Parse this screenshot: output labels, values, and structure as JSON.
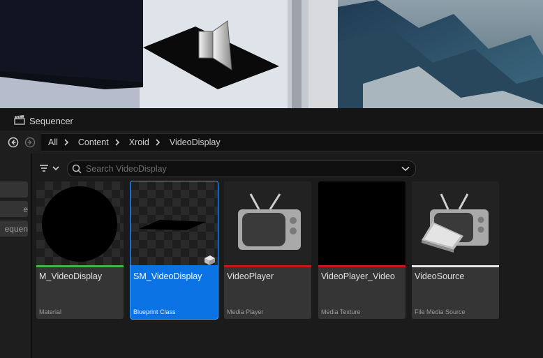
{
  "viewport": {
    "icons": {
      "speaker": "speaker-icon"
    }
  },
  "tab": {
    "title": "Sequencer",
    "icon": "clapperboard-icon"
  },
  "nav": {
    "back_icon": "back-arrow-icon",
    "forward_icon": "forward-arrow-icon",
    "breadcrumbs": [
      "All",
      "Content",
      "Xroid",
      "VideoDisplay"
    ]
  },
  "left_panel": {
    "items": [
      "",
      "e",
      "equen"
    ]
  },
  "toolbar": {
    "filter_icon": "filter-icon"
  },
  "search": {
    "placeholder": "Search VideoDisplay",
    "value": ""
  },
  "assets": [
    {
      "name": "M_VideoDisplay",
      "type": "Material",
      "color": "#3fb54a",
      "selected": false
    },
    {
      "name": "SM_VideoDisplay",
      "type": "Blueprint Class",
      "color": "#0a72e2",
      "selected": true
    },
    {
      "name": "VideoPlayer",
      "type": "Media Player",
      "color": "#c8161d",
      "selected": false
    },
    {
      "name": "VideoPlayer_Video",
      "type": "Media Texture",
      "color": "#c8161d",
      "selected": false
    },
    {
      "name": "VideoSource",
      "type": "File Media Source",
      "color": "#e8e8e8",
      "selected": false
    }
  ],
  "colors": {
    "accent": "#0a72e2",
    "panel": "#353535",
    "background": "#1b1b1b"
  }
}
